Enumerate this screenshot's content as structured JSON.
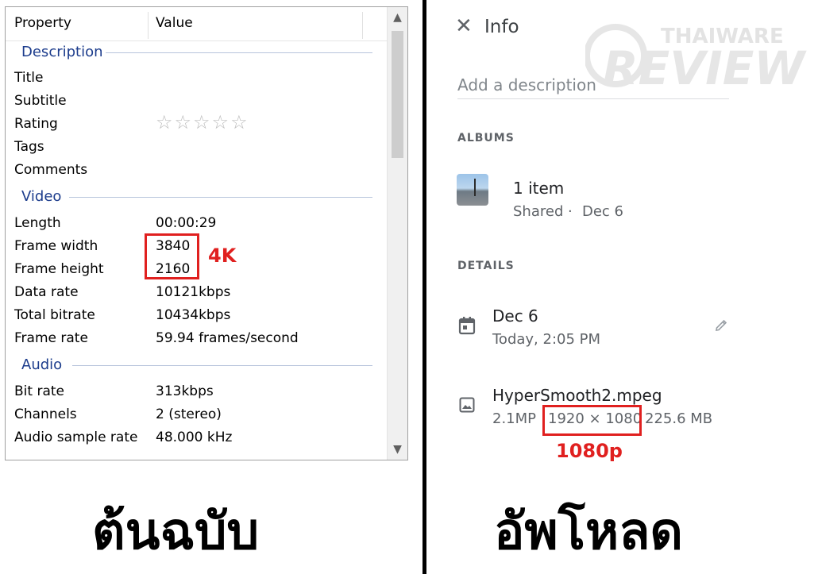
{
  "left_panel": {
    "header": {
      "property": "Property",
      "value": "Value"
    },
    "sections": {
      "description": "Description",
      "video": "Video",
      "audio": "Audio"
    },
    "description_rows": [
      "Title",
      "Subtitle",
      "Rating",
      "Tags",
      "Comments"
    ],
    "rating_stars": "☆☆☆☆☆",
    "video_rows": [
      {
        "label": "Length",
        "value": "00:00:29"
      },
      {
        "label": "Frame width",
        "value": "3840"
      },
      {
        "label": "Frame height",
        "value": "2160"
      },
      {
        "label": "Data rate",
        "value": "10121kbps"
      },
      {
        "label": "Total bitrate",
        "value": "10434kbps"
      },
      {
        "label": "Frame rate",
        "value": "59.94 frames/second"
      }
    ],
    "audio_rows": [
      {
        "label": "Bit rate",
        "value": "313kbps"
      },
      {
        "label": "Channels",
        "value": "2 (stereo)"
      },
      {
        "label": "Audio sample rate",
        "value": "48.000 kHz"
      }
    ],
    "annotation": "4K",
    "caption": "ต้นฉบับ"
  },
  "right_panel": {
    "title": "Info",
    "description_placeholder": "Add a description",
    "albums_label": "ALBUMS",
    "album": {
      "count": "1 item",
      "shared": "Shared",
      "dot": "·",
      "date": "Dec 6"
    },
    "details_label": "DETAILS",
    "date": {
      "primary": "Dec 6",
      "secondary": "Today, 2:05 PM"
    },
    "file": {
      "name": "HyperSmooth2.mpeg",
      "megapixels": "2.1MP",
      "resolution": "1920 × 1080",
      "size": "225.6 MB"
    },
    "annotation": "1080p",
    "caption": "อัพโหลด",
    "watermark": {
      "top": "THAIWARE",
      "bottom": "REVIEW"
    }
  },
  "icons": {
    "close": "close-icon",
    "calendar": "calendar-icon",
    "image": "image-icon",
    "edit": "pencil-icon"
  },
  "colors": {
    "annotation_red": "#e0201f",
    "section_blue": "#1c3c8c"
  }
}
